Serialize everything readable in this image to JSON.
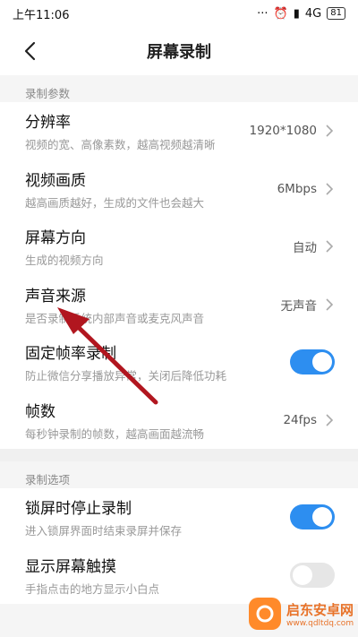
{
  "status_bar": {
    "time": "上午11:06",
    "network": "4G",
    "battery": "81"
  },
  "header": {
    "title": "屏幕录制"
  },
  "sections": [
    {
      "header": "录制参数",
      "items": [
        {
          "title": "分辨率",
          "subtitle": "视频的宽、高像素数，越高视频越清晰",
          "value": "1920*1080"
        },
        {
          "title": "视频画质",
          "subtitle": "越高画质越好，生成的文件也会越大",
          "value": "6Mbps"
        },
        {
          "title": "屏幕方向",
          "subtitle": "生成的视频方向",
          "value": "自动"
        },
        {
          "title": "声音来源",
          "subtitle": "是否录制系统内部声音或麦克风声音",
          "value": "无声音"
        },
        {
          "title": "固定帧率录制",
          "subtitle": "防止微信分享播放异常，关闭后降低功耗",
          "toggle": true
        },
        {
          "title": "帧数",
          "subtitle": "每秒钟录制的帧数，越高画面越流畅",
          "value": "24fps"
        }
      ]
    },
    {
      "header": "录制选项",
      "items": [
        {
          "title": "锁屏时停止录制",
          "subtitle": "进入锁屏界面时结束录屏并保存",
          "toggle": true
        },
        {
          "title": "显示屏幕触摸",
          "subtitle": "手指点击的地方显示小白点",
          "toggle": false
        }
      ]
    }
  ],
  "watermark": {
    "title": "启东安卓网",
    "url": "www.qdltdq.com"
  },
  "icons": {
    "back": "back-arrow-icon",
    "chevron": "chevron-right-icon",
    "alarm": "alarm-icon",
    "signal": "signal-icon"
  },
  "colors": {
    "accent": "#2d8ef0",
    "annotation": "#b1161f",
    "watermark": "#e8732a"
  }
}
